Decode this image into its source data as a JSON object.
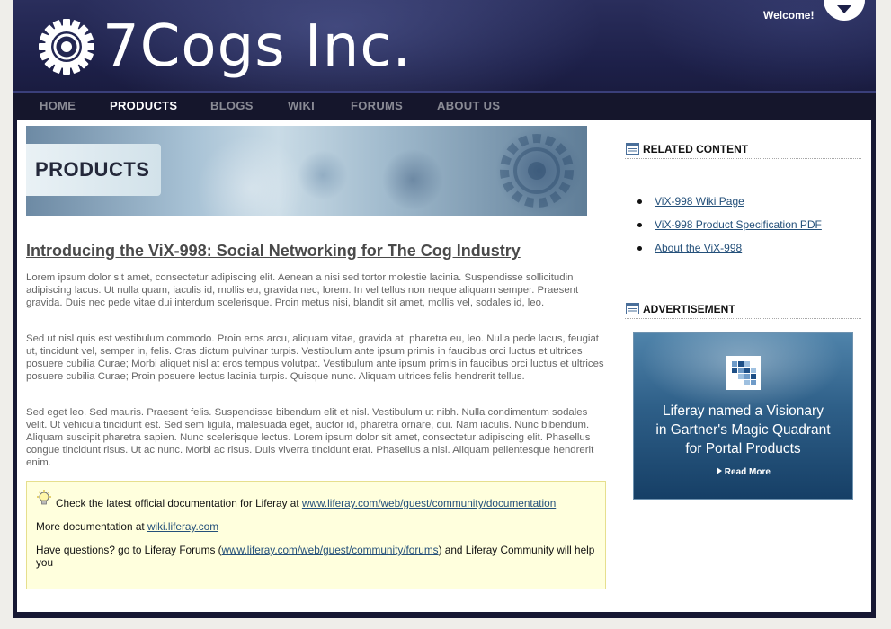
{
  "header": {
    "logo_text": "7Cogs Inc.",
    "welcome": "Welcome!"
  },
  "nav": {
    "items": [
      {
        "label": "HOME"
      },
      {
        "label": "PRODUCTS",
        "active": true
      },
      {
        "label": "BLOGS"
      },
      {
        "label": "WIKI"
      },
      {
        "label": "FORUMS"
      },
      {
        "label": "ABOUT US"
      }
    ]
  },
  "banner": {
    "label": "PRODUCTS"
  },
  "article": {
    "title": "Introducing the ViX-998: Social Networking for The Cog Industry",
    "paragraphs": [
      "Lorem ipsum dolor sit amet, consectetur adipiscing elit. Aenean a nisi sed tortor molestie lacinia. Suspendisse sollicitudin adipiscing lacus. Ut nulla quam, iaculis id, mollis eu, gravida nec, lorem. In vel tellus non neque aliquam semper. Praesent gravida. Duis nec pede vitae dui interdum scelerisque. Proin metus nisi, blandit sit amet, mollis vel, sodales id, leo.",
      "Sed ut nisl quis est vestibulum commodo. Proin eros arcu, aliquam vitae, gravida at, pharetra eu, leo. Nulla pede lacus, feugiat ut, tincidunt vel, semper in, felis. Cras dictum pulvinar turpis. Vestibulum ante ipsum primis in faucibus orci luctus et ultrices posuere cubilia Curae; Morbi aliquet nisl at eros tempus volutpat. Vestibulum ante ipsum primis in faucibus orci luctus et ultrices posuere cubilia Curae; Proin posuere lectus lacinia turpis. Quisque nunc. Aliquam ultrices felis hendrerit tellus.",
      "Sed eget leo. Sed mauris. Praesent felis. Suspendisse bibendum elit et nisl. Vestibulum ut nibh. Nulla condimentum sodales velit. Ut vehicula tincidunt est. Sed sem ligula, malesuada eget, auctor id, pharetra ornare, dui. Nam iaculis. Nunc bibendum. Aliquam suscipit pharetra sapien. Nunc scelerisque lectus. Lorem ipsum dolor sit amet, consectetur adipiscing elit. Phasellus congue tincidunt risus. Ut ac nunc. Morbi ac risus. Duis viverra tincidunt erat. Phasellus a nisi. Aliquam pellentesque hendrerit enim."
    ]
  },
  "note": {
    "line1_prefix": "Check the latest official documentation for Liferay at ",
    "line1_link": "www.liferay.com/web/guest/community/documentation",
    "line2_prefix": "More documentation at ",
    "line2_link": "wiki.liferay.com",
    "line3_prefix": "Have questions? go to Liferay Forums (",
    "line3_link": "www.liferay.com/web/guest/community/forums",
    "line3_suffix": ") and Liferay Community will help you"
  },
  "related": {
    "title": "RELATED CONTENT",
    "links": [
      "ViX-998 Wiki Page",
      "ViX-998 Product Specification PDF",
      "About the ViX-998"
    ]
  },
  "advertisement": {
    "title": "ADVERTISEMENT",
    "line1": "Liferay named a Visionary",
    "line2": "in Gartner's Magic Quadrant",
    "line3": "for Portal Products",
    "read_more": "Read More"
  },
  "icons": {
    "logo": "cog-icon",
    "dock": "chevron-down-icon",
    "note": "lightbulb-icon",
    "portlet": "portlet-window-icon",
    "read_more": "triangle-right-icon"
  }
}
